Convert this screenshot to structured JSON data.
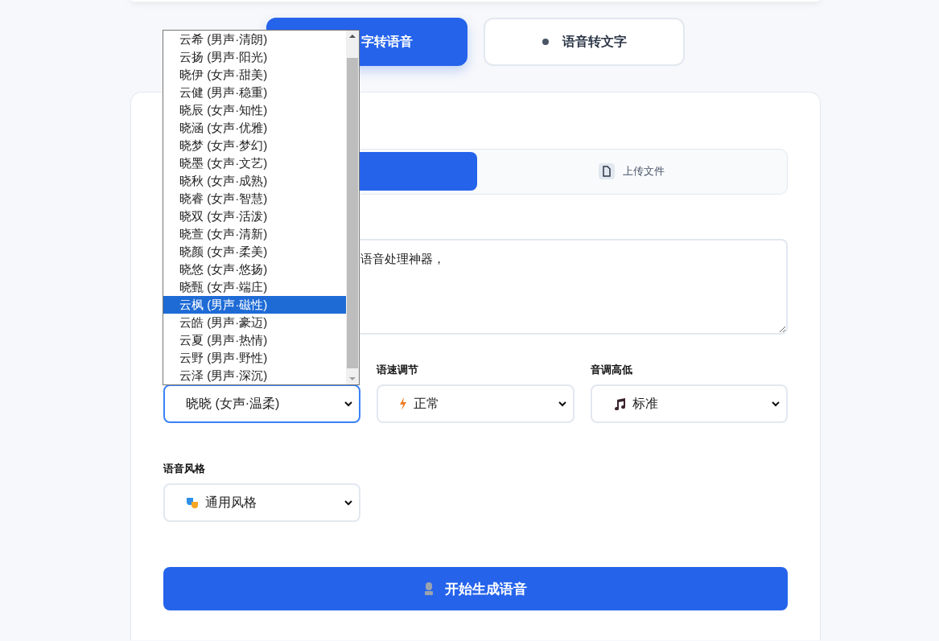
{
  "mode_tabs": [
    {
      "label": "字转语音",
      "selected": true
    },
    {
      "label": "语音转文字",
      "selected": false
    }
  ],
  "input_tabs": [
    {
      "selected": true
    },
    {
      "label": "上传文件",
      "selected": false
    }
  ],
  "text_input": {
    "value": "语音处理神器，"
  },
  "settings": [
    {
      "kind": "voice",
      "value": "晓晓 (女声·温柔)",
      "focused": true
    },
    {
      "kind": "speed",
      "label": "语速调节",
      "value": "正常",
      "focused": false
    },
    {
      "kind": "pitch",
      "label": "音调高低",
      "value": "标准",
      "focused": false
    },
    {
      "kind": "style",
      "label": "语音风格",
      "value": "通用风格",
      "focused": false
    }
  ],
  "voice_dropdown": {
    "options": [
      {
        "label": "云希 (男声·清朗)",
        "selected": false
      },
      {
        "label": "云扬 (男声·阳光)",
        "selected": false
      },
      {
        "label": "晓伊 (女声·甜美)",
        "selected": false
      },
      {
        "label": "云健 (男声·稳重)",
        "selected": false
      },
      {
        "label": "晓辰 (女声·知性)",
        "selected": false
      },
      {
        "label": "晓涵 (女声·优雅)",
        "selected": false
      },
      {
        "label": "晓梦 (女声·梦幻)",
        "selected": false
      },
      {
        "label": "晓墨 (女声·文艺)",
        "selected": false
      },
      {
        "label": "晓秋 (女声·成熟)",
        "selected": false
      },
      {
        "label": "晓睿 (女声·智慧)",
        "selected": false
      },
      {
        "label": "晓双 (女声·活泼)",
        "selected": false
      },
      {
        "label": "晓萱 (女声·清新)",
        "selected": false
      },
      {
        "label": "晓颜 (女声·柔美)",
        "selected": false
      },
      {
        "label": "晓悠 (女声·悠扬)",
        "selected": false
      },
      {
        "label": "晓甄 (女声·端庄)",
        "selected": false
      },
      {
        "label": "云枫 (男声·磁性)",
        "selected": true
      },
      {
        "label": "云皓 (男声·豪迈)",
        "selected": false
      },
      {
        "label": "云夏 (男声·热情)",
        "selected": false
      },
      {
        "label": "云野 (男声·野性)",
        "selected": false
      },
      {
        "label": "云泽 (男声·深沉)",
        "selected": false
      }
    ]
  },
  "generate_button": {
    "label": "开始生成语音"
  }
}
